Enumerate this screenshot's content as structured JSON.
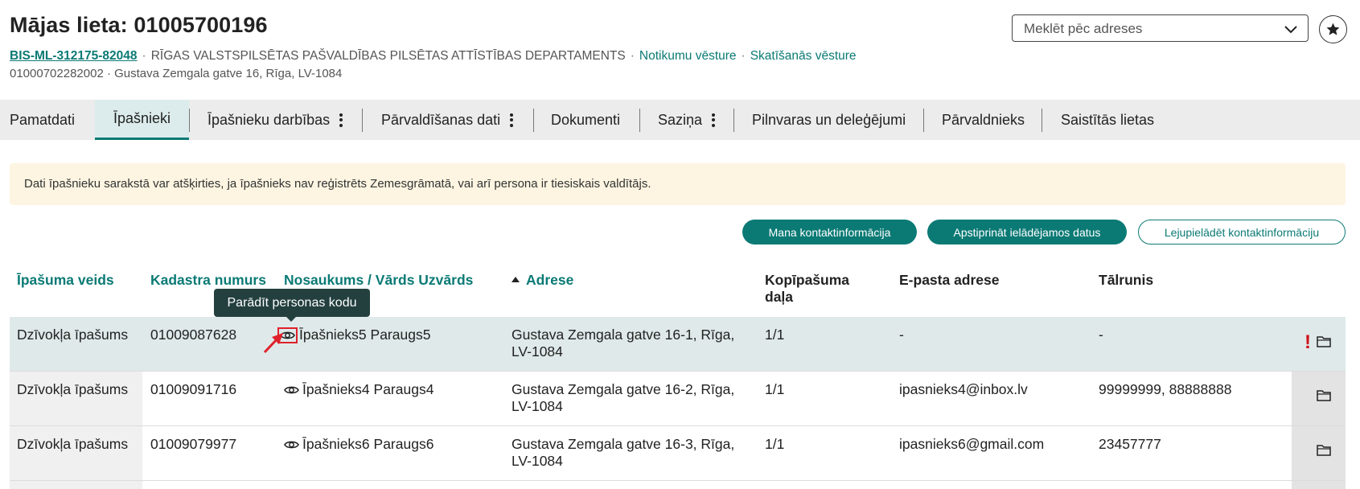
{
  "header": {
    "title": "Mājas lieta: 01005700196",
    "case_id": "BIS-ML-312175-82048",
    "department": "RĪGAS VALSTSPILSĒTAS PAŠVALDĪBAS PILSĒTAS ATTĪSTĪBAS DEPARTAMENTS",
    "event_history_link": "Notikumu vēsture",
    "view_history_link": "Skatīšanās vēsture",
    "cadastre_address": "01000702282002 · Gustava Zemgala gatve 16, Rīga, LV-1084",
    "search_placeholder": "Meklēt pēc adreses"
  },
  "tabs": [
    {
      "label": "Pamatdati"
    },
    {
      "label": "Īpašnieki",
      "active": true
    },
    {
      "label": "Īpašnieku darbības",
      "has_menu": true
    },
    {
      "label": "Pārvaldīšanas dati",
      "has_menu": true
    },
    {
      "label": "Dokumenti"
    },
    {
      "label": "Saziņa",
      "has_menu": true
    },
    {
      "label": "Pilnvaras un deleģējumi"
    },
    {
      "label": "Pārvaldnieks"
    },
    {
      "label": "Saistītās lietas"
    }
  ],
  "info_banner": "Dati īpašnieku sarakstā var atšķirties, ja īpašnieks nav reģistrēts Zemesgrāmatā, vai arī persona ir tiesiskais valdītājs.",
  "actions": {
    "my_contact": "Mana kontaktinformācija",
    "confirm_import": "Apstiprināt ielādējamos datus",
    "download_contact": "Lejupielādēt kontaktinformāciju"
  },
  "table": {
    "columns": {
      "type": "Īpašuma veids",
      "cadastre": "Kadastra numurs",
      "name": "Nosaukums / Vārds Uzvārds",
      "address": "Adrese",
      "share": "Kopīpašuma daļa",
      "email": "E-pasta adrese",
      "phone": "Tālrunis"
    },
    "rows": [
      {
        "type": "Dzīvokļa īpašums",
        "cadastre": "01009087628",
        "name": "Īpašnieks5 Paraugs5",
        "address": "Gustava Zemgala gatve 16-1, Rīga, LV-1084",
        "share": "1/1",
        "email": "-",
        "phone": "-",
        "warning": "!"
      },
      {
        "type": "Dzīvokļa īpašums",
        "cadastre": "01009091716",
        "name": "Īpašnieks4 Paraugs4",
        "address": "Gustava Zemgala gatve 16-2, Rīga, LV-1084",
        "share": "1/1",
        "email": "ipasnieks4@inbox.lv",
        "phone": "99999999, 88888888"
      },
      {
        "type": "Dzīvokļa īpašums",
        "cadastre": "01009079977",
        "name": "Īpašnieks6 Paraugs6",
        "address": "Gustava Zemgala gatve 16-3, Rīga, LV-1084",
        "share": "1/1",
        "email": "ipasnieks6@gmail.com",
        "phone": "23457777"
      }
    ]
  },
  "tooltip": "Parādīt personas kodu",
  "colors": {
    "accent": "#0b7a75",
    "warning": "#d0101a",
    "highlight": "#e0202a"
  },
  "icons": [
    "chevron-down-icon",
    "star-icon",
    "eye-icon",
    "folder-icon",
    "sort-asc-icon",
    "kebab-menu-icon"
  ]
}
